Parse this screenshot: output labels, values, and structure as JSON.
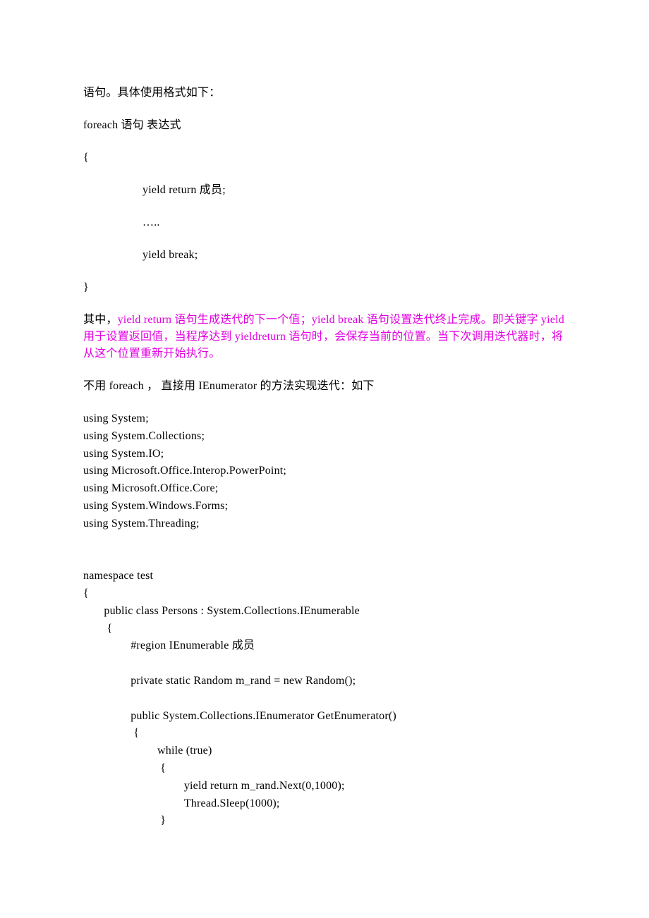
{
  "p1": "语句。具体使用格式如下：",
  "p2": "foreach 语句 表达式",
  "p3": "{",
  "p4": "yield return 成员;",
  "p5": "…..",
  "p6": "yield break;",
  "p7": "}",
  "hl_prefix": "其中，",
  "hl_body": "yield return 语句生成迭代的下一个值；yield break 语句设置迭代终止完成。即关键字 yield 用于设置返回值，当程序达到 yieldreturn 语句时，会保存当前的位置。当下次调用迭代器时，将从这个位置重新开始执行。",
  "p9": "不用 foreach ， 直接用 IEnumerator 的方法实现迭代：如下",
  "code": {
    "l1": "using System;",
    "l2": "using System.Collections;",
    "l3": "using System.IO;",
    "l4": "using Microsoft.Office.Interop.PowerPoint;",
    "l5": "using Microsoft.Office.Core;",
    "l6": "using System.Windows.Forms;",
    "l7": "using System.Threading;",
    "l8": "",
    "l9": "",
    "l10": "namespace test",
    "l11": "{",
    "l12": "       public class Persons : System.Collections.IEnumerable",
    "l13": "        {",
    "l14": "                #region IEnumerable 成员",
    "l15": "",
    "l16": "                private static Random m_rand = new Random();",
    "l17": "",
    "l18": "                public System.Collections.IEnumerator GetEnumerator()",
    "l19": "                 {",
    "l20": "                         while (true)",
    "l21": "                          {",
    "l22": "                                  yield return m_rand.Next(0,1000);",
    "l23": "                                  Thread.Sleep(1000);",
    "l24": "                          }"
  }
}
